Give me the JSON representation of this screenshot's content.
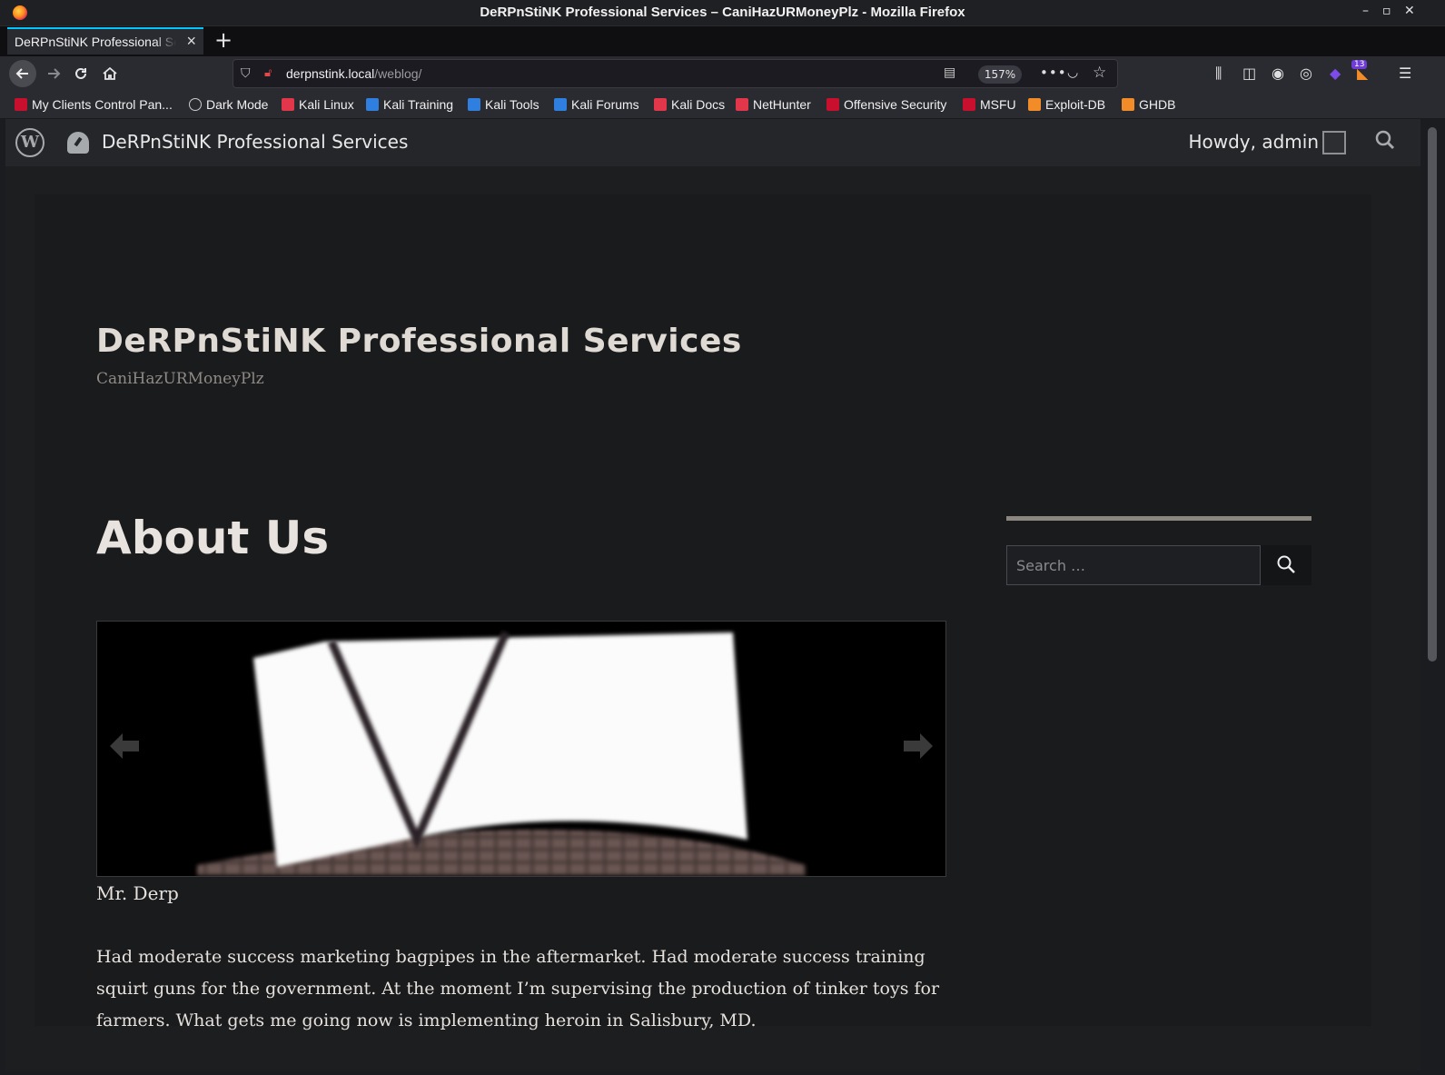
{
  "window": {
    "title": "DeRPnStiNK Professional Services – CaniHazURMoneyPlz - Mozilla Firefox",
    "controls": {
      "minimize": "–",
      "maximize": "▫",
      "close": "✕"
    }
  },
  "tab": {
    "label": "DeRPnStiNK Professional Services – CaniHazURMoneyPlz",
    "close": "×",
    "new_tab": "+"
  },
  "nav": {
    "url_host": "derpnstink.local",
    "url_path": "/weblog/",
    "zoom": "157%",
    "extension_badge": "13"
  },
  "bookmarks": [
    {
      "label": "My Clients Control Pan...",
      "icon": "red-flag-icon",
      "color": "#c8102e"
    },
    {
      "label": "Dark Mode",
      "icon": "globe-icon",
      "color": "#cccccc"
    },
    {
      "label": "Kali Linux",
      "icon": "kali-icon",
      "color": "#e2374a"
    },
    {
      "label": "Kali Training",
      "icon": "kali-icon",
      "color": "#2f7fe0"
    },
    {
      "label": "Kali Tools",
      "icon": "kali-icon",
      "color": "#2f7fe0"
    },
    {
      "label": "Kali Forums",
      "icon": "kali-icon",
      "color": "#2f7fe0"
    },
    {
      "label": "Kali Docs",
      "icon": "kali-docs-icon",
      "color": "#e2374a"
    },
    {
      "label": "NetHunter",
      "icon": "kali-icon",
      "color": "#e2374a"
    },
    {
      "label": "Offensive Security",
      "icon": "red-flag-icon",
      "color": "#c8102e"
    },
    {
      "label": "MSFU",
      "icon": "red-flag-icon",
      "color": "#c8102e"
    },
    {
      "label": "Exploit-DB",
      "icon": "exploitdb-icon",
      "color": "#f28c28"
    },
    {
      "label": "GHDB",
      "icon": "exploitdb-icon",
      "color": "#f28c28"
    }
  ],
  "adminbar": {
    "site_name": "DeRPnStiNK Professional Services",
    "howdy": "Howdy, admin"
  },
  "header": {
    "site_title": "DeRPnStiNK Professional Services",
    "tagline": "CaniHazURMoneyPlz"
  },
  "main": {
    "title": "About Us",
    "slide_caption": "Mr. Derp",
    "body": "Had moderate success marketing bagpipes in the aftermarket. Had moderate success training squirt guns for the government. At the moment I’m supervising the production of tinker toys for farmers. What gets me going now is implementing heroin in Salisbury, MD."
  },
  "sidebar": {
    "search_placeholder": "Search …"
  },
  "colors": {
    "accent_tab": "#00c8ff",
    "page_bg": "#1a1b1d",
    "text": "#e6e1dc"
  }
}
